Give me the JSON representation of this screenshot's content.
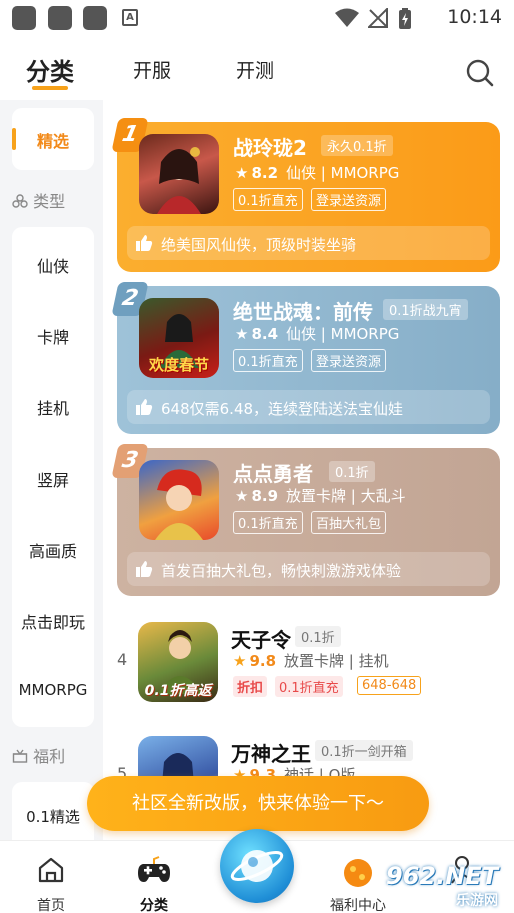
{
  "status_bar": {
    "time": "10:14",
    "notif_icon_letter": "A"
  },
  "top_tabs": [
    {
      "label": "分类",
      "active": true
    },
    {
      "label": "开服",
      "active": false
    },
    {
      "label": "开测",
      "active": false
    }
  ],
  "sidebar": {
    "selected": "精选",
    "section_type": "类型",
    "type_items": [
      "仙侠",
      "卡牌",
      "挂机",
      "竖屏",
      "高画质",
      "点击即玩",
      "MMORPG"
    ],
    "section_welfare": "福利",
    "welfare_items": [
      "0.1精选"
    ]
  },
  "games": [
    {
      "rank": "1",
      "title": "战玲珑2",
      "subtitle": "永久0.1折",
      "score": "8.2",
      "genre": "仙侠 | MMORPG",
      "tags": [
        "0.1折直充",
        "登录送资源"
      ],
      "desc": "绝美国风仙侠，顶级时装坐骑",
      "theme": "#f9a42a"
    },
    {
      "rank": "2",
      "title": "绝世战魂：前传",
      "subtitle": "0.1折战九宵",
      "score": "8.4",
      "genre": "仙侠 | MMORPG",
      "tags": [
        "0.1折直充",
        "登录送资源"
      ],
      "desc": "648仅需6.48，连续登陆送法宝仙娃",
      "icon_text": "欢度春节",
      "theme": "#8fb7cf"
    },
    {
      "rank": "3",
      "title": "点点勇者",
      "subtitle": "0.1折",
      "score": "8.9",
      "genre": "放置卡牌 | 大乱斗",
      "tags": [
        "0.1折直充",
        "百抽大礼包"
      ],
      "desc": "首发百抽大礼包，畅快刺激游戏体验",
      "theme": "#c9ab98"
    },
    {
      "rank": "4",
      "title": "天子令",
      "subtitle": "0.1折",
      "score": "9.8",
      "genre": "放置卡牌 | 挂机",
      "tags": [
        "折扣",
        "0.1折直充",
        "648-648"
      ],
      "icon_text": "0.1折高返"
    },
    {
      "rank": "5",
      "title": "万神之王",
      "subtitle": "0.1折一剑开箱",
      "score": "9.3",
      "genre": "神话 | Q版"
    }
  ],
  "float_banner": "社区全新改版，快来体验一下～",
  "bottom_nav": [
    {
      "label": "首页"
    },
    {
      "label": "分类",
      "active": true
    },
    {
      "label": ""
    },
    {
      "label": "福利中心"
    },
    {
      "label": ""
    }
  ],
  "watermark": {
    "brand": "962.NET",
    "sub": "乐游网"
  },
  "colors": {
    "accent": "#f7a21b",
    "rating_star": "#f7a21b",
    "tag_red": "#e84a4a"
  }
}
